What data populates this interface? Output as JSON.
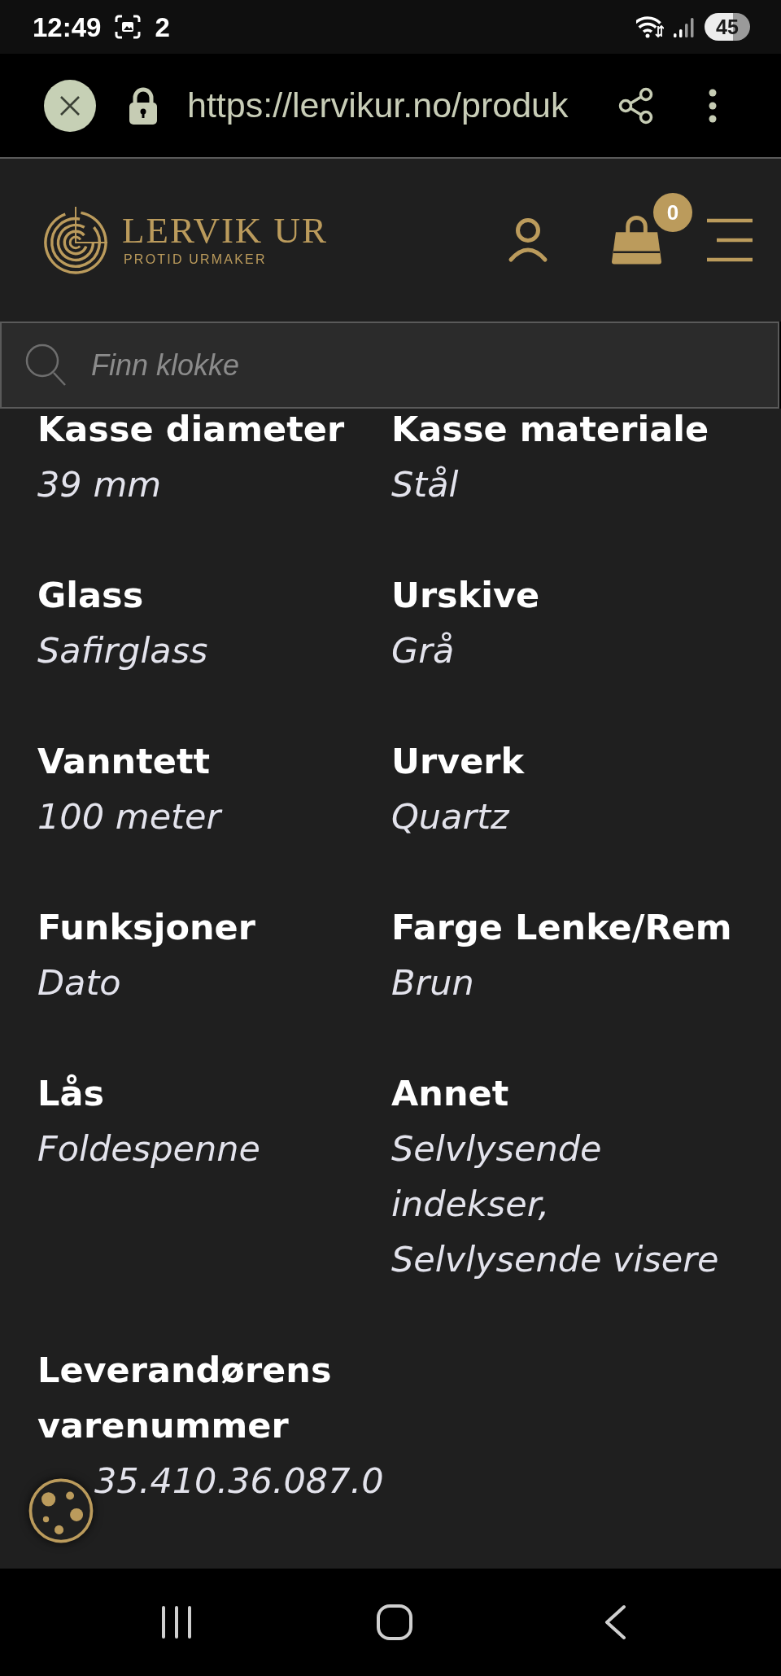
{
  "status_bar": {
    "time": "12:49",
    "notification": "2",
    "battery": "45"
  },
  "browser": {
    "url": "https://lervikur.no/produk"
  },
  "header": {
    "logo_name": "LERVIK UR",
    "logo_tagline": "PROTID URMAKER",
    "cart_count": "0"
  },
  "search": {
    "placeholder": "Finn klokke"
  },
  "specs": [
    {
      "label": "Kasse diameter",
      "value": "39 mm"
    },
    {
      "label": "Kasse materiale",
      "value": "Stål"
    },
    {
      "label": "Glass",
      "value": "Safirglass"
    },
    {
      "label": "Urskive",
      "value": "Grå"
    },
    {
      "label": "Vanntett",
      "value": "100 meter"
    },
    {
      "label": "Urverk",
      "value": "Quartz"
    },
    {
      "label": "Funksjoner",
      "value": "Dato"
    },
    {
      "label": "Farge Lenke/Rem",
      "value": "Brun"
    },
    {
      "label": "Lås",
      "value": "Foldespenne"
    },
    {
      "label": "Annet",
      "value": "Selvlysende indekser, Selvlysende visere"
    },
    {
      "label": "Leverandørens varenummer",
      "value": "35.410.36.087.0"
    }
  ]
}
